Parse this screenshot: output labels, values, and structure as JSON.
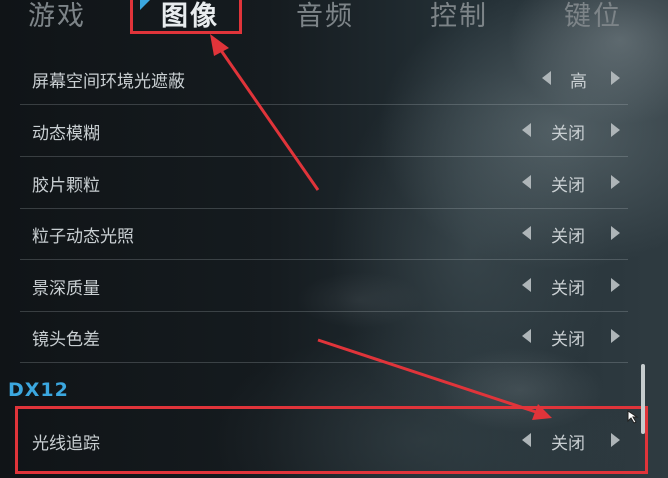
{
  "tabs": [
    {
      "label": "游戏",
      "active": false
    },
    {
      "label": "图像",
      "active": true
    },
    {
      "label": "音频",
      "active": false
    },
    {
      "label": "控制",
      "active": false
    },
    {
      "label": "键位",
      "active": false
    }
  ],
  "settings": [
    {
      "label": "屏幕空间环境光遮蔽",
      "value": "高"
    },
    {
      "label": "动态模糊",
      "value": "关闭"
    },
    {
      "label": "胶片颗粒",
      "value": "关闭"
    },
    {
      "label": "粒子动态光照",
      "value": "关闭"
    },
    {
      "label": "景深质量",
      "value": "关闭"
    },
    {
      "label": "镜头色差",
      "value": "关闭"
    }
  ],
  "section": {
    "title": "DX12"
  },
  "dx12_settings": [
    {
      "label": "光线追踪",
      "value": "关闭"
    }
  ],
  "colors": {
    "accent": "#3ba7df",
    "annotation": "#e0343a",
    "text": "#c9cfd2"
  }
}
